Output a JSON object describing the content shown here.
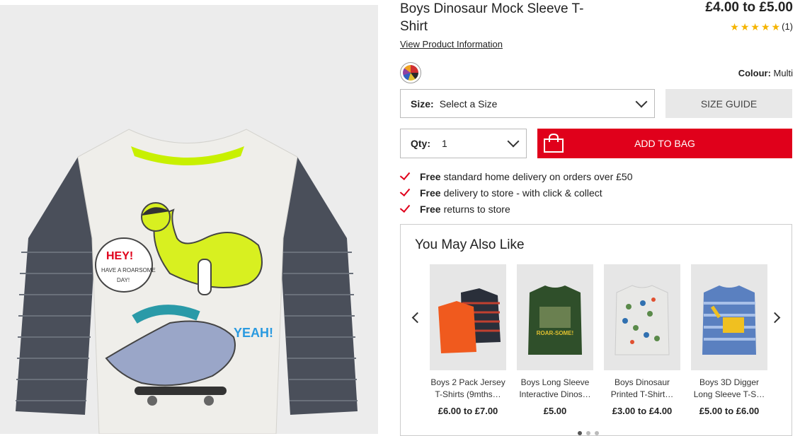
{
  "product": {
    "title_line1": "Boys Dinosaur Mock Sleeve T-",
    "title_line2": "Shirt",
    "price": "£4.00 to £5.00",
    "rating_count": "(1)",
    "rating_value": 5,
    "product_info_link": "View Product Information",
    "colour_label": "Colour:",
    "colour_value": "Multi",
    "hero_image_text": {
      "speech_line1": "HEY!",
      "speech_line2": "HAVE A ROARSOME",
      "speech_line3": "DAY!",
      "yeah": "YEAH!"
    }
  },
  "size": {
    "label": "Size:",
    "value": "Select a Size",
    "guide_button": "SIZE GUIDE"
  },
  "qty": {
    "label": "Qty:",
    "value": "1"
  },
  "add_to_bag": "ADD TO BAG",
  "perks": [
    {
      "bold": "Free",
      "text": "standard home delivery on orders over £50"
    },
    {
      "bold": "Free",
      "text": "delivery to store - with click & collect"
    },
    {
      "bold": "Free",
      "text": "returns to store"
    }
  ],
  "recommendations": {
    "heading": "You May Also Like",
    "items": [
      {
        "name_line1": "Boys 2 Pack Jersey",
        "name_line2": "T-Shirts (9mths…",
        "price": "£6.00 to £7.00",
        "image_text": ""
      },
      {
        "name_line1": "Boys Long Sleeve",
        "name_line2": "Interactive Dinos…",
        "price": "£5.00",
        "image_text": "ROAR-SOME!"
      },
      {
        "name_line1": "Boys Dinosaur",
        "name_line2": "Printed T-Shirt…",
        "price": "£3.00 to £4.00",
        "image_text": ""
      },
      {
        "name_line1": "Boys 3D Digger",
        "name_line2": "Long Sleeve T-S…",
        "price": "£5.00 to £6.00",
        "image_text": ""
      }
    ]
  },
  "colors": {
    "accent_red": "#e0001b",
    "star": "#f5b400"
  }
}
